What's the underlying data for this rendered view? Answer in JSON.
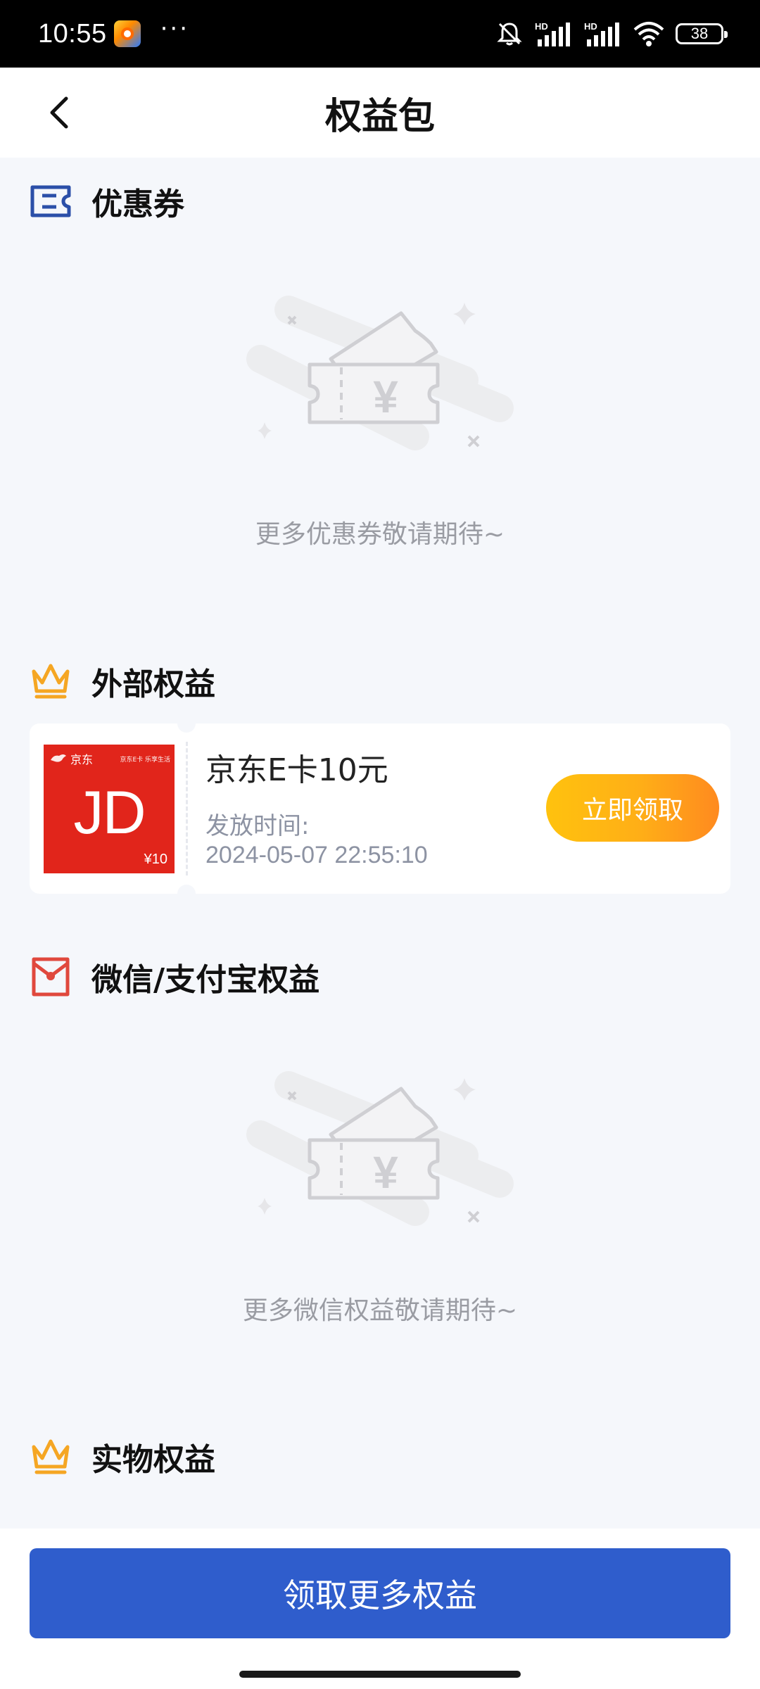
{
  "status_bar": {
    "time": "10:55",
    "more": "···",
    "battery": "38",
    "icons": [
      "mute-bell-icon",
      "hd-signal-icon",
      "hd-signal-icon",
      "wifi-icon",
      "battery-icon"
    ]
  },
  "header": {
    "title": "权益包",
    "back_icon": "chevron-left-icon"
  },
  "sections": {
    "coupons": {
      "title": "优惠券",
      "icon": "ticket-icon",
      "empty_text": "更多优惠券敬请期待~"
    },
    "external": {
      "title": "外部权益",
      "icon": "crown-icon",
      "card": {
        "brand": "京东",
        "slogan": "京东E卡 乐享生活",
        "logo": "JD",
        "value": "¥10",
        "name": "京东E卡10元",
        "time_label": "发放时间:",
        "time": "2024-05-07 22:55:10",
        "button": "立即领取"
      }
    },
    "wechat": {
      "title": "微信/支付宝权益",
      "icon": "red-envelope-icon",
      "empty_text": "更多微信权益敬请期待~"
    },
    "physical": {
      "title": "实物权益",
      "icon": "crown-icon"
    }
  },
  "bottom": {
    "button": "领取更多权益"
  },
  "colors": {
    "primary_blue": "#2f5dcc",
    "crown_gold": "#f5a623",
    "claim_orange": "#ffae17",
    "jd_red": "#e1251b",
    "envelope_red": "#e0483d",
    "background": "#f5f7fb"
  }
}
